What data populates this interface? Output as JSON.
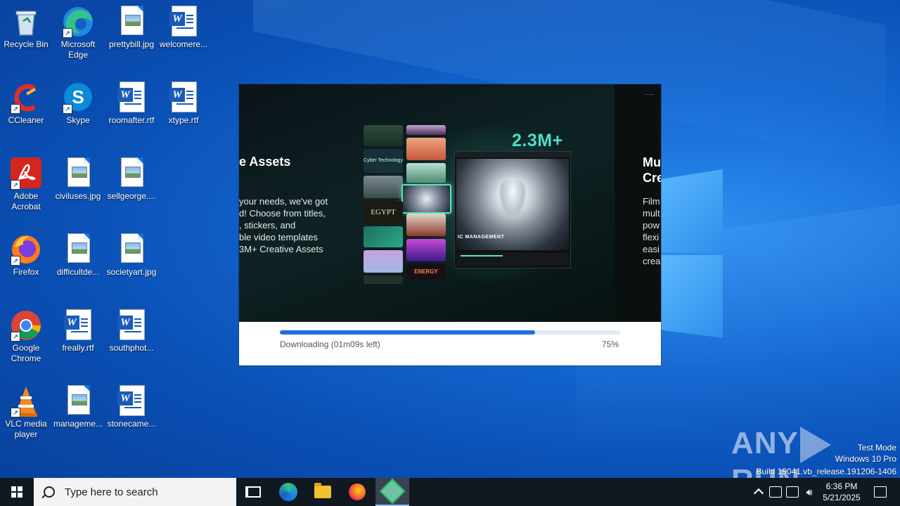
{
  "desktop": {
    "icons": [
      {
        "label": "Recycle Bin"
      },
      {
        "label": "Microsoft Edge"
      },
      {
        "label": "prettybill.jpg"
      },
      {
        "label": "welcomere..."
      },
      {
        "label": "CCleaner"
      },
      {
        "label": "Skype"
      },
      {
        "label": "roomafter.rtf"
      },
      {
        "label": "xtype.rtf"
      },
      {
        "label": "Adobe Acrobat"
      },
      {
        "label": "civiluses.jpg"
      },
      {
        "label": "sellgeorge...."
      },
      {
        "label": "Firefox"
      },
      {
        "label": "difficultde..."
      },
      {
        "label": "societyart.jpg"
      },
      {
        "label": "Google Chrome"
      },
      {
        "label": "freally.rtf"
      },
      {
        "label": "southphot..."
      },
      {
        "label": "VLC media player"
      },
      {
        "label": "manageme..."
      },
      {
        "label": "stonecame..."
      }
    ]
  },
  "installer": {
    "slide_title": "e Assets",
    "slide_body": "your needs, we've got\nd! Choose from titles,\n, stickers, and\nble video templates\n3M+ Creative Assets",
    "stat": "2.3M+",
    "next_title": "Mu\nCre",
    "next_body": "Film\nmult\npow\nflexi\neasi\ncrea",
    "thumb_labels": {
      "cyber": "Cyber Technology",
      "egypt": "EGYPT",
      "energy": "ENERGY"
    },
    "preview_caption": "IC MANAGEMENT",
    "progress_text": "Downloading (01m09s left)",
    "progress_pct_label": "75%",
    "progress_value": 0.75
  },
  "watermark": {
    "brand_left": "ANY",
    "brand_right": "RUN",
    "line1": "Test Mode",
    "line2": "Windows 10 Pro",
    "line3": "Build 19041.vb_release.191206-1406"
  },
  "taskbar": {
    "search_placeholder": "Type here to search",
    "time": "6:36 PM",
    "date": "5/21/2025"
  }
}
